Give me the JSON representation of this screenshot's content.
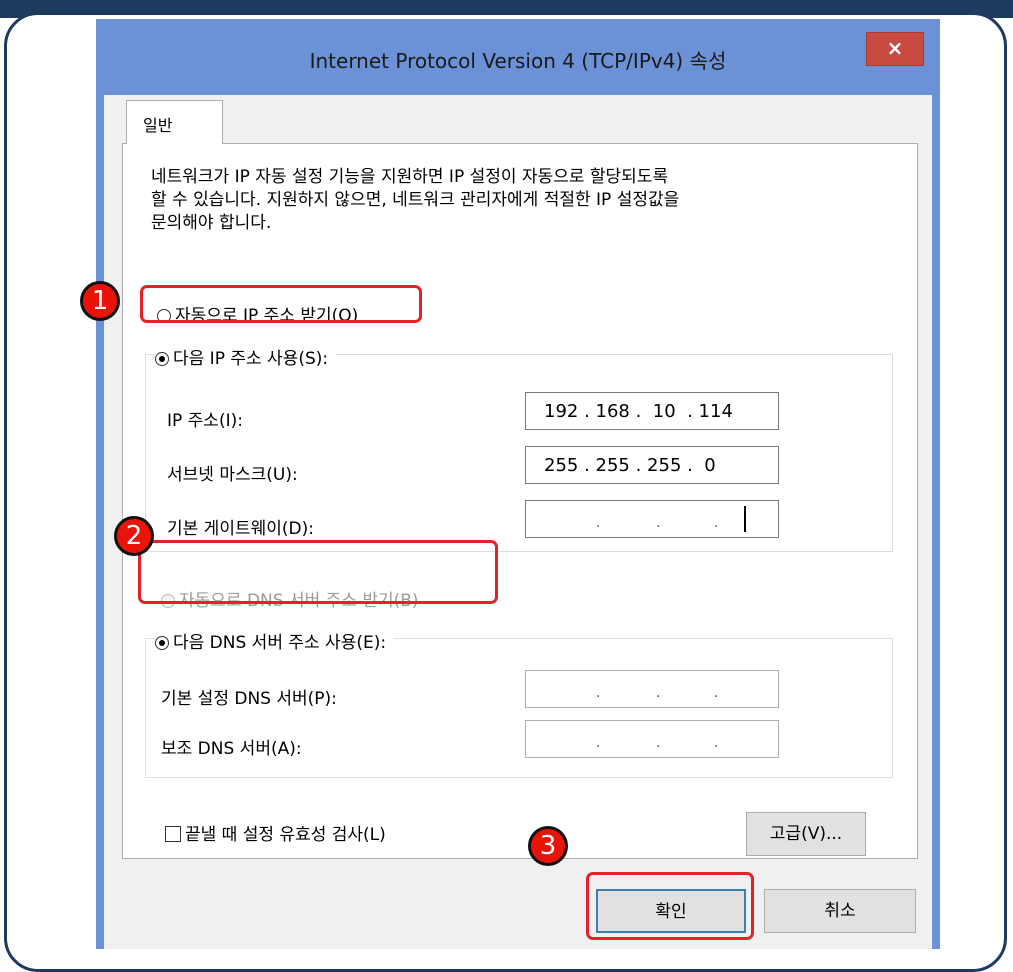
{
  "dialog": {
    "title": "Internet Protocol Version 4 (TCP/IPv4) 속성",
    "close_label": "×",
    "tab_label": "일반",
    "intro_lines": [
      "네트워크가 IP 자동 설정 기능을 지원하면 IP 설정이 자동으로 할당되도록",
      "할 수 있습니다. 지원하지 않으면, 네트워크 관리자에게 적절한 IP 설정값을",
      "문의해야 합니다."
    ],
    "ip": {
      "auto_label": "자동으로 IP 주소 받기(O)",
      "auto_checked": false,
      "manual_label": "다음 IP 주소 사용(S):",
      "manual_checked": true,
      "fields": [
        {
          "label": "IP 주소(I):",
          "value": "192 . 168 .  10  . 114"
        },
        {
          "label": "서브넷 마스크(U):",
          "value": "255 . 255 . 255 .  0"
        },
        {
          "label": "기본 게이트웨이(D):",
          "value": ""
        }
      ]
    },
    "dns": {
      "auto_label": "자동으로 DNS 서버 주소 받기(B)",
      "auto_disabled": true,
      "manual_label": "다음 DNS 서버 주소 사용(E):",
      "manual_checked": true,
      "fields": [
        {
          "label": "기본 설정 DNS 서버(P):",
          "value": ""
        },
        {
          "label": "보조 DNS 서버(A):",
          "value": ""
        }
      ]
    },
    "validate_label": "끝낼 때 설정 유효성 검사(L)",
    "validate_checked": false,
    "advanced_label": "고급(V)...",
    "ok_label": "확인",
    "cancel_label": "취소"
  },
  "markers": [
    "1",
    "2",
    "3"
  ],
  "colors": {
    "frame": "#1e3a5c",
    "dialog_border": "#6b91d6",
    "close_button": "#c74b41",
    "marker": "#e8140a",
    "highlight": "#e32228"
  }
}
